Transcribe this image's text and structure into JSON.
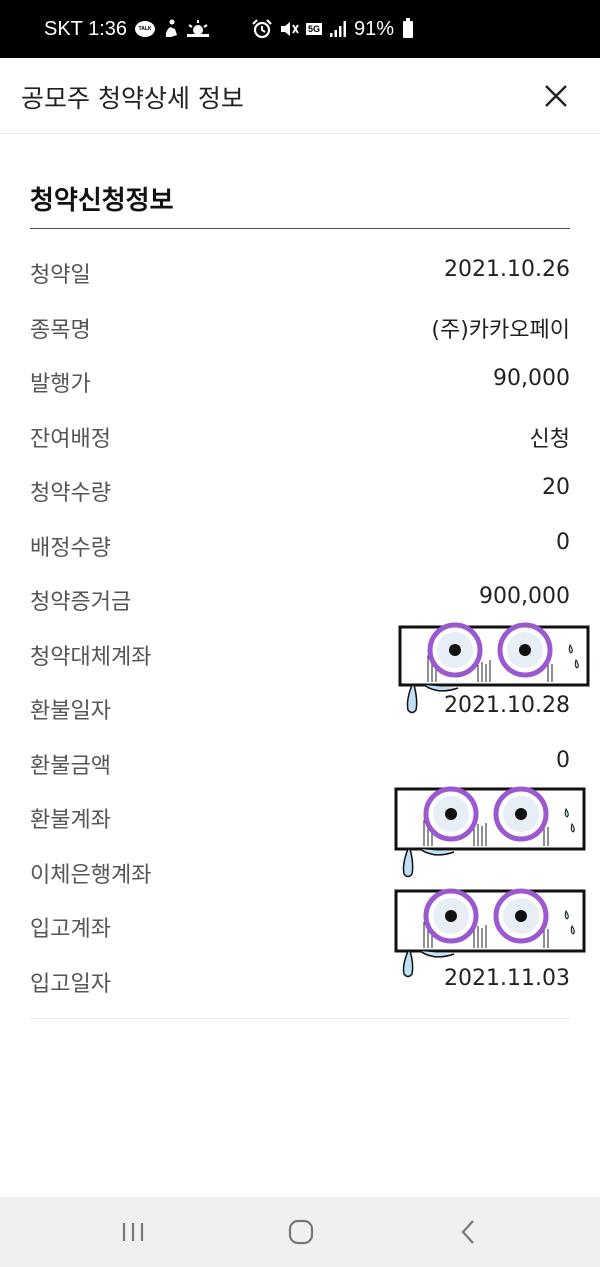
{
  "status_bar": {
    "carrier_time": "SKT 1:36",
    "talk_label": "TALK",
    "network": "5G",
    "battery": "91%"
  },
  "header": {
    "title": "공모주 청약상세 정보"
  },
  "section": {
    "title": "청약신청정보",
    "rows": [
      {
        "label": "청약일",
        "value": "2021.10.26"
      },
      {
        "label": "종목명",
        "value": "(주)카카오페이"
      },
      {
        "label": "발행가",
        "value": "90,000"
      },
      {
        "label": "잔여배정",
        "value": "신청"
      },
      {
        "label": "청약수량",
        "value": "20"
      },
      {
        "label": "배정수량",
        "value": "0"
      },
      {
        "label": "청약증거금",
        "value": "900,000"
      },
      {
        "label": "청약대체계좌",
        "value": ""
      },
      {
        "label": "환불일자",
        "value": "2021.10.28"
      },
      {
        "label": "환불금액",
        "value": "0"
      },
      {
        "label": "환불계좌",
        "value": ""
      },
      {
        "label": "이체은행계좌",
        "value": ""
      },
      {
        "label": "입고계좌",
        "value": ""
      },
      {
        "label": "입고일자",
        "value": "2021.11.03"
      }
    ]
  },
  "colors": {
    "status_bar_bg": "#000000",
    "nav_bar_bg": "#f0f0f0",
    "sticker_purple": "#9b59d0"
  }
}
